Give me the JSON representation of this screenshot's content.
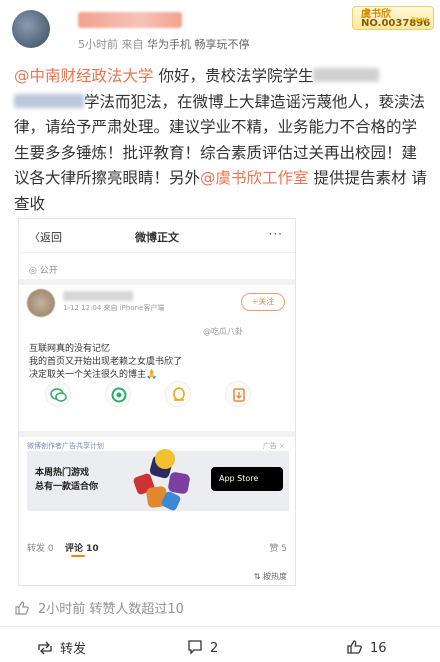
{
  "header": {
    "meta_time": "5小时前",
    "meta_from": "来自",
    "meta_source": "华为手机 畅享玩不停",
    "badge_line1": "虞书欣",
    "badge_line2": "NO.0037896",
    "badge_tag": "FANS"
  },
  "post": {
    "mention1": "@中南财经政法大学",
    "text1": " 你好，贵校法学院学生",
    "text1b": "学法而犯法，在微博上大肆造谣污蔑他人，亵渎法律，请给予严肃处理。建议学业不精，业务能力不合格的学生要多多锤炼！批评教育！综合素质评估过关再出校园！建议各大律所擦亮眼睛！另外",
    "mention2": "@虞书欣工作室",
    "text2": " 提供提告素材 请查收"
  },
  "card": {
    "back": "〈返回",
    "title": "微博正文",
    "more": "···",
    "visibility": "公开",
    "time": "1-12 12:04  来自 iPhone客户端",
    "follow": "+关注",
    "watermark": "@吃瓜八卦",
    "lines": [
      "互联网真的没有记忆",
      "我的首页又开始出现老赖之女虞书欣了",
      "决定取关一个关注很久的博主🙏"
    ],
    "ad_header": "微博创作者广告共享计划",
    "ad_tag": "广告 ×",
    "ad_line1": "本周热门游戏",
    "ad_line2": "总有一款适合你",
    "ad_button": "App Store",
    "tab_repost": "转发 0",
    "tab_comment": "评论 10",
    "tab_like": "赞 5",
    "sort": "按热度"
  },
  "footer": {
    "stats": "2小时前 转赞人数超过10",
    "repost": "转发",
    "comments": "2",
    "likes": "16"
  },
  "colors": {
    "accent": "#eb7350",
    "link": "#eb7350",
    "muted": "#939393"
  }
}
